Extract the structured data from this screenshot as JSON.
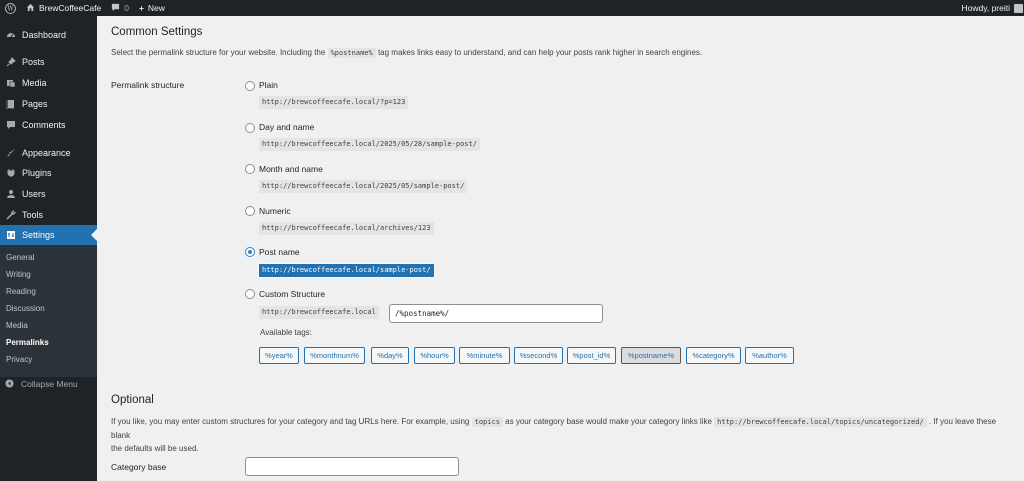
{
  "adminbar": {
    "site_name": "BrewCoffeeCafe",
    "comments_count": "0",
    "new_label": "New",
    "greeting": "Howdy, preiti"
  },
  "sidebar": {
    "items": [
      {
        "label": "Dashboard",
        "icon": "dashboard-icon"
      },
      {
        "label": "Posts",
        "icon": "pin-icon"
      },
      {
        "label": "Media",
        "icon": "media-icon"
      },
      {
        "label": "Pages",
        "icon": "pages-icon"
      },
      {
        "label": "Comments",
        "icon": "comment-icon"
      },
      {
        "label": "Appearance",
        "icon": "brush-icon"
      },
      {
        "label": "Plugins",
        "icon": "plugin-icon"
      },
      {
        "label": "Users",
        "icon": "users-icon"
      },
      {
        "label": "Tools",
        "icon": "wrench-icon"
      },
      {
        "label": "Settings",
        "icon": "settings-icon"
      }
    ],
    "submenu": [
      "General",
      "Writing",
      "Reading",
      "Discussion",
      "Media",
      "Permalinks",
      "Privacy"
    ],
    "collapse_label": "Collapse Menu"
  },
  "common": {
    "title": "Common Settings",
    "desc_before": "Select the permalink structure for your website. Including the",
    "desc_code": "%postname%",
    "desc_after": "tag makes links easy to understand, and can help your posts rank higher in search engines.",
    "row_label": "Permalink structure",
    "options": [
      {
        "label": "Plain",
        "example": "http://brewcoffeecafe.local/?p=123",
        "checked": false
      },
      {
        "label": "Day and name",
        "example": "http://brewcoffeecafe.local/2025/05/28/sample-post/",
        "checked": false
      },
      {
        "label": "Month and name",
        "example": "http://brewcoffeecafe.local/2025/05/sample-post/",
        "checked": false
      },
      {
        "label": "Numeric",
        "example": "http://brewcoffeecafe.local/archives/123",
        "checked": false
      },
      {
        "label": "Post name",
        "example": "http://brewcoffeecafe.local/sample-post/",
        "checked": true
      },
      {
        "label": "Custom Structure",
        "checked": false
      }
    ],
    "custom_prefix": "http://brewcoffeecafe.local",
    "custom_value": "/%postname%/",
    "available_tags_label": "Available tags:",
    "tags": [
      "%year%",
      "%monthnum%",
      "%day%",
      "%hour%",
      "%minute%",
      "%second%",
      "%post_id%",
      "%postname%",
      "%category%",
      "%author%"
    ],
    "active_tag": "%postname%"
  },
  "optional": {
    "title": "Optional",
    "desc_before": "If you like, you may enter custom structures for your category and tag URLs here. For example, using",
    "desc_code1": "topics",
    "desc_mid": "as your category base would make your category links like",
    "desc_code2": "http://brewcoffeecafe.local/topics/uncategorized/",
    "desc_after": ". If you leave these blank",
    "desc_line2": "the defaults will be used.",
    "category_base_label": "Category base",
    "category_base_value": ""
  },
  "colors": {
    "sidebar_bg": "#1d2327",
    "accent": "#2271b1",
    "page_bg": "#f0f0f1"
  }
}
